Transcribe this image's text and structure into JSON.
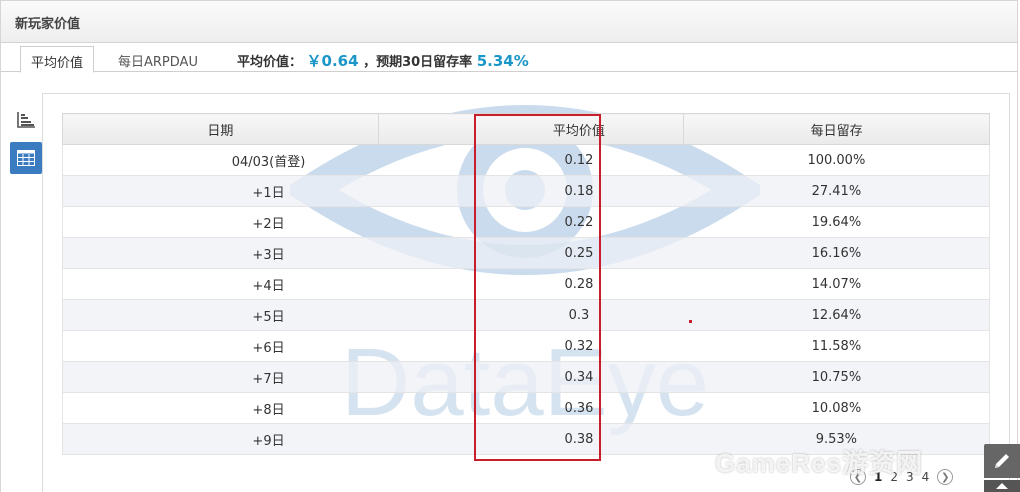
{
  "panel": {
    "title": "新玩家价值"
  },
  "tabs": [
    {
      "label": "平均价值"
    },
    {
      "label": "每日ARPDAU"
    }
  ],
  "summary": {
    "avg_label": "平均价值：",
    "avg_value": "￥0.64",
    "retention_label": "，预期30日留存率",
    "retention_value": "5.34%"
  },
  "sidebar": {
    "chart_icon": "bar-chart-icon",
    "table_icon": "table-icon"
  },
  "table": {
    "headers": [
      "日期",
      "",
      "平均价值",
      "每日留存"
    ],
    "rows": [
      {
        "date": "04/03(首登)",
        "value": "0.12",
        "retention": "100.00%"
      },
      {
        "date": "+1日",
        "value": "0.18",
        "retention": "27.41%"
      },
      {
        "date": "+2日",
        "value": "0.22",
        "retention": "19.64%"
      },
      {
        "date": "+3日",
        "value": "0.25",
        "retention": "16.16%"
      },
      {
        "date": "+4日",
        "value": "0.28",
        "retention": "14.07%"
      },
      {
        "date": "+5日",
        "value": "0.3",
        "retention": "12.64%"
      },
      {
        "date": "+6日",
        "value": "0.32",
        "retention": "11.58%"
      },
      {
        "date": "+7日",
        "value": "0.34",
        "retention": "10.75%"
      },
      {
        "date": "+8日",
        "value": "0.36",
        "retention": "10.08%"
      },
      {
        "date": "+9日",
        "value": "0.38",
        "retention": "9.53%"
      }
    ]
  },
  "pager": {
    "pages": [
      "1",
      "2",
      "3",
      "4"
    ],
    "current": "1"
  },
  "watermark": {
    "brand": "DataEye",
    "site": "GameRes游资网"
  },
  "colors": {
    "accent": "#1a96c8",
    "highlight": "#c81e2b",
    "watermark": "#3f7fc0",
    "sidebar_active": "#3b7cc1"
  }
}
